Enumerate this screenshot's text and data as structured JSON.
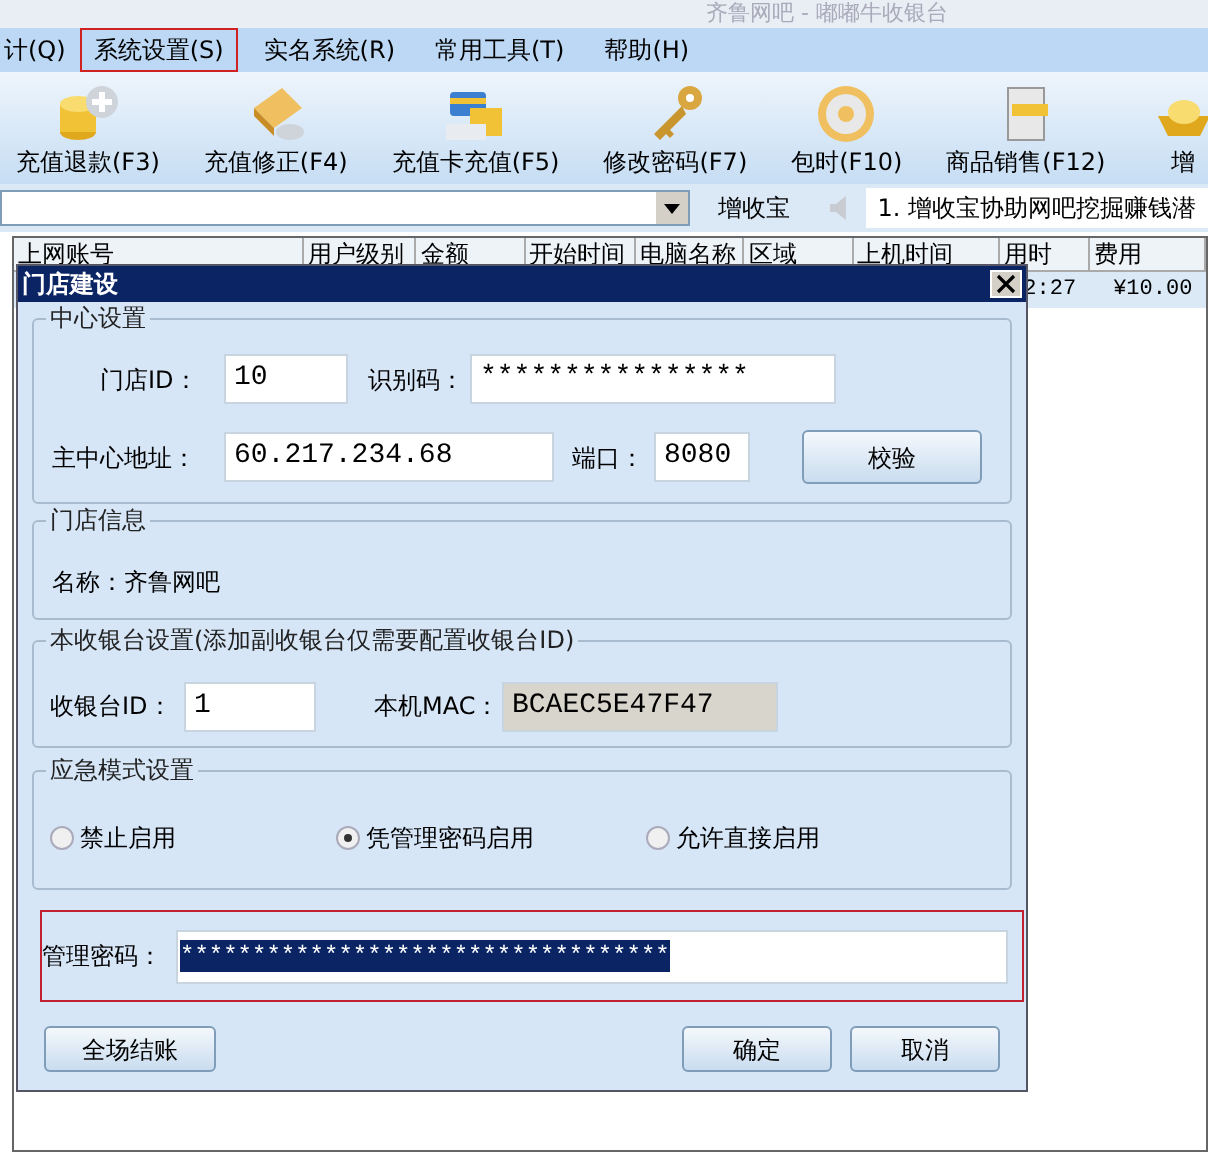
{
  "window": {
    "title": "齐鲁网吧 - 嘟嘟牛收银台"
  },
  "menu": [
    {
      "label": "计(Q)",
      "selected": false
    },
    {
      "label": "系统设置(S)",
      "selected": true
    },
    {
      "label": "实名系统(R)",
      "selected": false
    },
    {
      "label": "常用工具(T)",
      "selected": false
    },
    {
      "label": "帮助(H)",
      "selected": false
    }
  ],
  "toolbar": [
    {
      "label": "充值退款(F3)",
      "kind": "coins"
    },
    {
      "label": "充值修正(F4)",
      "kind": "book"
    },
    {
      "label": "充值卡充值(F5)",
      "kind": "card"
    },
    {
      "label": "修改密码(F7)",
      "kind": "keys"
    },
    {
      "label": "包时(F10)",
      "kind": "disc"
    },
    {
      "label": "商品销售(F12)",
      "kind": "box"
    },
    {
      "label": "增",
      "kind": "gold"
    }
  ],
  "ticker": {
    "label": "增收宝",
    "message": "1. 增收宝协助网吧挖掘赚钱潜"
  },
  "table": {
    "columns": [
      "上网账号",
      "用户级别",
      "金额",
      "开始时间",
      "电脑名称",
      "区域",
      "上机时间",
      "用时",
      "费用"
    ],
    "rows": [
      [
        "",
        "",
        "",
        "",
        "",
        "",
        "",
        "2:27",
        "¥10.00"
      ]
    ]
  },
  "dialog": {
    "title": "门店建设",
    "center": {
      "legend": "中心设置",
      "store_id_label": "门店ID：",
      "store_id": "10",
      "code_label": "识别码：",
      "code": "****************",
      "address_label": "主中心地址：",
      "address": "60.217.234.68",
      "port_label": "端口：",
      "port": "8080",
      "verify_button": "校验"
    },
    "store_info": {
      "legend": "门店信息",
      "name": "名称：齐鲁网吧"
    },
    "cashier": {
      "legend": "本收银台设置(添加副收银台仅需要配置收银台ID)",
      "id_label": "收银台ID：",
      "id": "1",
      "mac_label": "本机MAC：",
      "mac": "BCAEC5E47F47"
    },
    "emergency": {
      "legend": "应急模式设置",
      "options": [
        {
          "label": "禁止启用",
          "selected": false
        },
        {
          "label": "凭管理密码启用",
          "selected": true
        },
        {
          "label": "允许直接启用",
          "selected": false
        }
      ]
    },
    "admin_password": {
      "label": "管理密码：",
      "value": "**********************************",
      "highlighted": true
    },
    "buttons": [
      {
        "label": "全场结账"
      },
      {
        "label": "确定"
      },
      {
        "label": "取消"
      }
    ]
  }
}
